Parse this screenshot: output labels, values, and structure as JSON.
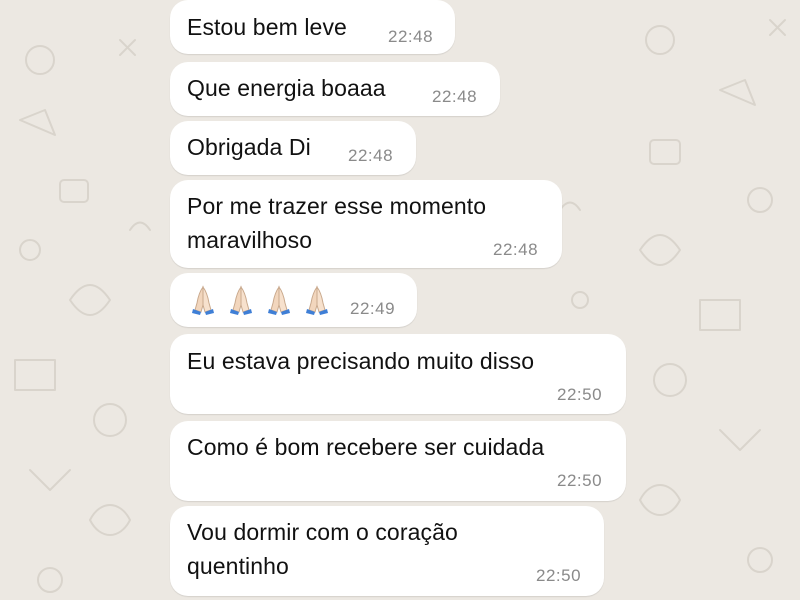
{
  "messages": [
    {
      "lines": [
        "Estou bem leve"
      ],
      "time": "22:48"
    },
    {
      "lines": [
        "Que energia boaaa"
      ],
      "time": "22:48"
    },
    {
      "lines": [
        "Obrigada Di"
      ],
      "time": "22:48"
    },
    {
      "lines": [
        "Por me trazer esse momento",
        "maravilhoso"
      ],
      "time": "22:48"
    },
    {
      "emoji": "🙏🏻🙏🏻🙏🏻🙏🏻",
      "emoji_name": "folded-hands-icon",
      "emoji_count": 4,
      "time": "22:49"
    },
    {
      "lines": [
        "Eu estava precisando muito disso"
      ],
      "time": "22:50"
    },
    {
      "lines": [
        "Como é bom recebere ser cuidada"
      ],
      "time": "22:50"
    },
    {
      "lines": [
        "Vou dormir com o coração",
        "quentinho"
      ],
      "time": "22:50"
    }
  ],
  "colors": {
    "background": "#ece8e2",
    "bubble": "#ffffff",
    "timestamp": "#8a8a8a",
    "text": "#111111"
  }
}
